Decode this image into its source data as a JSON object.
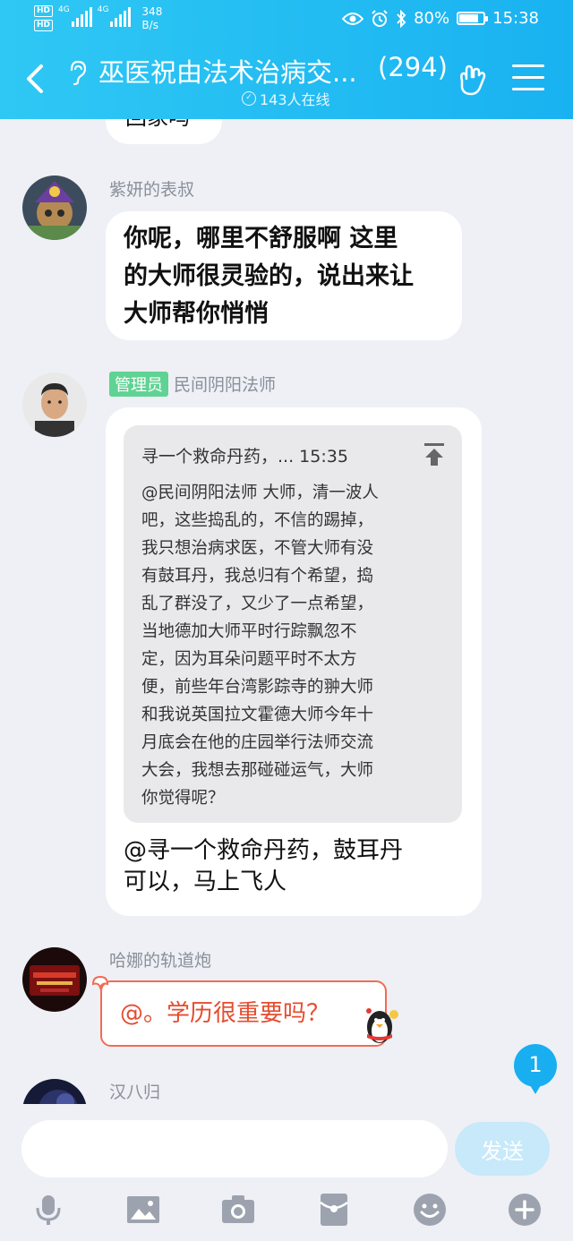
{
  "status_bar": {
    "network_labels": [
      "HD",
      "HD",
      "4G",
      "4G"
    ],
    "speed_value": "348",
    "speed_unit": "B/s",
    "battery": "80%",
    "battery_level": 0.8,
    "time": "15:38"
  },
  "header": {
    "title": "巫医祝由法术治病交...",
    "member_count": "(294)",
    "online_text": "143人在线"
  },
  "messages": [
    {
      "sender": "",
      "text_partial": "回家吗"
    },
    {
      "sender": "紫妍的表叔",
      "lines": [
        "你呢，哪里不舒服啊  这里",
        "的大师很灵验的，说出来让",
        "大师帮你悄悄"
      ]
    },
    {
      "role": "管理员",
      "sender": "民间阴阳法师",
      "quote": {
        "header": "寻一个救命丹药，... 15:35",
        "lines": [
          "@民间阴阳法师 大师，清一波人",
          "吧，这些捣乱的，不信的踢掉，",
          "我只想治病求医，不管大师有没",
          "有鼓耳丹，我总归有个希望，捣",
          "乱了群没了，又少了一点希望，",
          "当地德加大师平时行踪飘忽不",
          "定，因为耳朵问题平时不太方",
          "便，前些年台湾影踪寺的翀大师",
          "和我说英国拉文霍德大师今年十",
          "月底会在他的庄园举行法师交流",
          "大会，我想去那碰碰运气，大师",
          "你觉得呢？"
        ]
      },
      "reply_lines": [
        "@寻一个救命丹药，鼓耳丹",
        "可以，马上飞人"
      ]
    },
    {
      "sender": "哈娜的轨道炮",
      "text": "@。学历很重要吗？"
    },
    {
      "sender": "汉八归"
    }
  ],
  "unread_count": "1",
  "composer": {
    "placeholder": "",
    "send_label": "发送"
  },
  "colors": {
    "header_blue": "#19b2f1",
    "admin_green": "#5fd393",
    "festive_red": "#e54c2e"
  },
  "icons": [
    "back-icon",
    "ear-icon",
    "hand-gesture-icon",
    "menu-icon",
    "microphone-icon",
    "image-icon",
    "camera-icon",
    "red-packet-icon",
    "emoji-icon",
    "plus-icon"
  ]
}
